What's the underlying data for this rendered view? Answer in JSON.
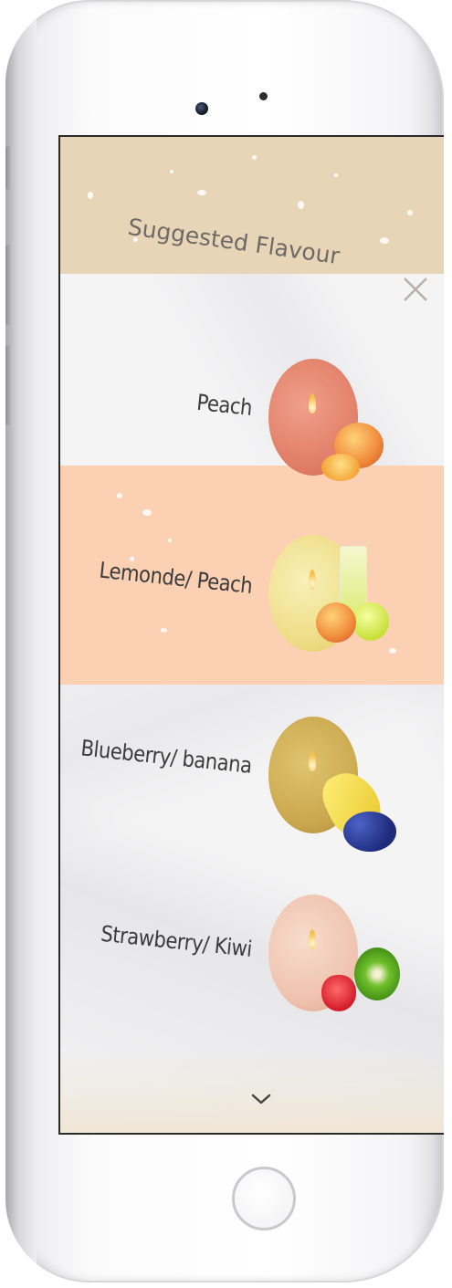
{
  "header": {
    "title": "Suggested Flavour",
    "close_icon": "close-x-icon"
  },
  "flavors": [
    {
      "name": "Peach",
      "candle_color": "#e98b74",
      "fruits": [
        "peach"
      ]
    },
    {
      "name": "Lemonde/ Peach",
      "candle_color": "#f2e39a",
      "fruits": [
        "lemonade-glass",
        "lemon",
        "peach"
      ]
    },
    {
      "name": "Blueberry/ banana",
      "candle_color": "#c9a64c",
      "fruits": [
        "banana",
        "blueberries"
      ]
    },
    {
      "name": "Strawberry/ Kiwi",
      "candle_color": "#f0c2b0",
      "fruits": [
        "kiwi",
        "strawberry"
      ]
    }
  ],
  "footer": {
    "scroll_icon": "chevron-down-icon"
  },
  "colors": {
    "header_bg": "#e8d5b8",
    "highlight_band": "#fcd0b2",
    "title_text": "#6d6a66",
    "item_text": "#3b3b3b"
  }
}
